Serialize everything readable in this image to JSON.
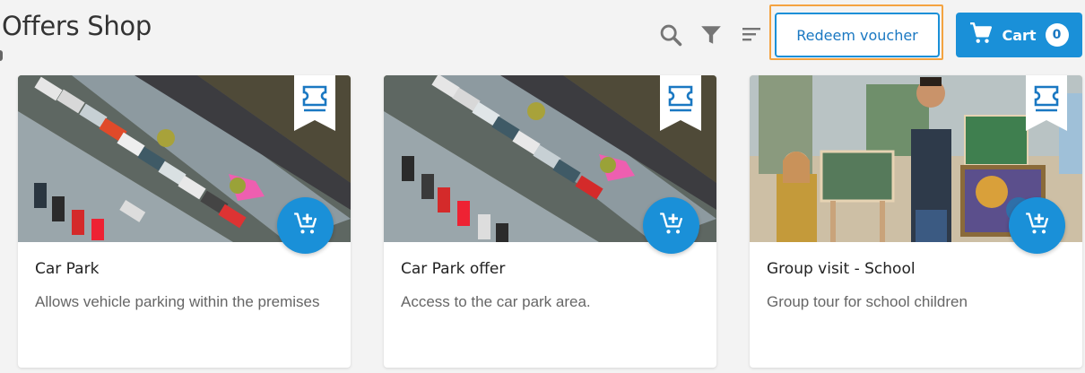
{
  "page": {
    "title": "Offers Shop"
  },
  "toolbar": {
    "search_icon": "search-icon",
    "filter_icon": "filter-icon",
    "sort_icon": "sort-icon",
    "redeem_label": "Redeem voucher",
    "cart_label": "Cart",
    "cart_count": "0"
  },
  "colors": {
    "accent": "#1a90d8",
    "focus_outline": "#f4a340",
    "background": "#f3f3f3"
  },
  "offers": [
    {
      "title": "Car Park",
      "description": "Allows vehicle parking within the premises",
      "image": "aerial-car-park-photo",
      "badge_icon": "ticket-icon",
      "action_icon": "add-to-cart-icon"
    },
    {
      "title": "Car Park offer",
      "description": "Access to the car park area.",
      "image": "aerial-car-park-photo",
      "badge_icon": "ticket-icon",
      "action_icon": "add-to-cart-icon"
    },
    {
      "title": "Group visit - School",
      "description": "Group tour for school children",
      "image": "art-class-photo",
      "badge_icon": "ticket-icon",
      "action_icon": "add-to-cart-icon"
    }
  ]
}
